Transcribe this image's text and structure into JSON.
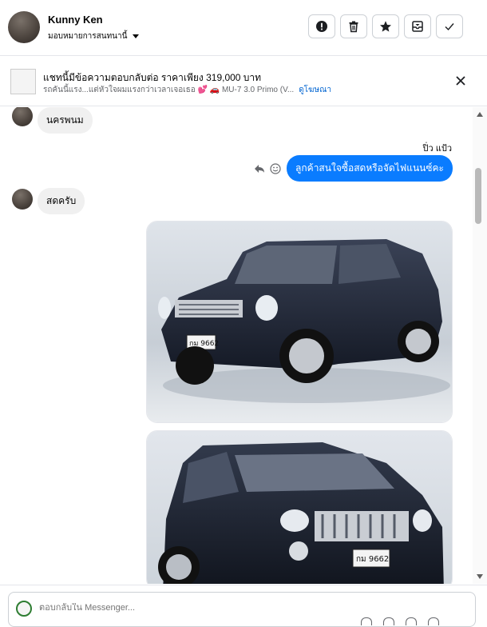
{
  "header": {
    "contact_name": "Kunny Ken",
    "assign_label": "มอบหมายการสนทนานี้",
    "actions": [
      "alert-icon",
      "trash-icon",
      "star-icon",
      "archive-icon",
      "check-icon"
    ]
  },
  "ad_banner": {
    "title": "แชทนี้มีข้อความตอบกลับต่อ ราคาเพียง 319,000 บาท",
    "subtitle": "รถคันนี้แรง...แต่หัวใจผมแรงกว่าเวลาเจอเธอ 💕 🚗 MU-7 3.0 Primo (V...",
    "link_label": "ดูโฆษณา"
  },
  "messages": [
    {
      "direction": "incoming",
      "text": "นครพนม"
    },
    {
      "direction": "outgoing",
      "sender_label": "ปิ่ว แป้ว",
      "text": "ลูกค้าสนใจซื้อสดหรือจัดไฟแนนซ์คะ"
    },
    {
      "direction": "incoming",
      "text": "สดครับ"
    }
  ],
  "photos": [
    {
      "plate": "กม 9662",
      "alt": "car-photo-side"
    },
    {
      "plate": "กม 9662",
      "alt": "car-photo-front"
    }
  ],
  "composer": {
    "placeholder": "ตอบกลับใน Messenger..."
  },
  "colors": {
    "outgoing_bubble": "#0a7cff",
    "incoming_bubble": "#f0f0f0",
    "link": "#0064d1"
  }
}
